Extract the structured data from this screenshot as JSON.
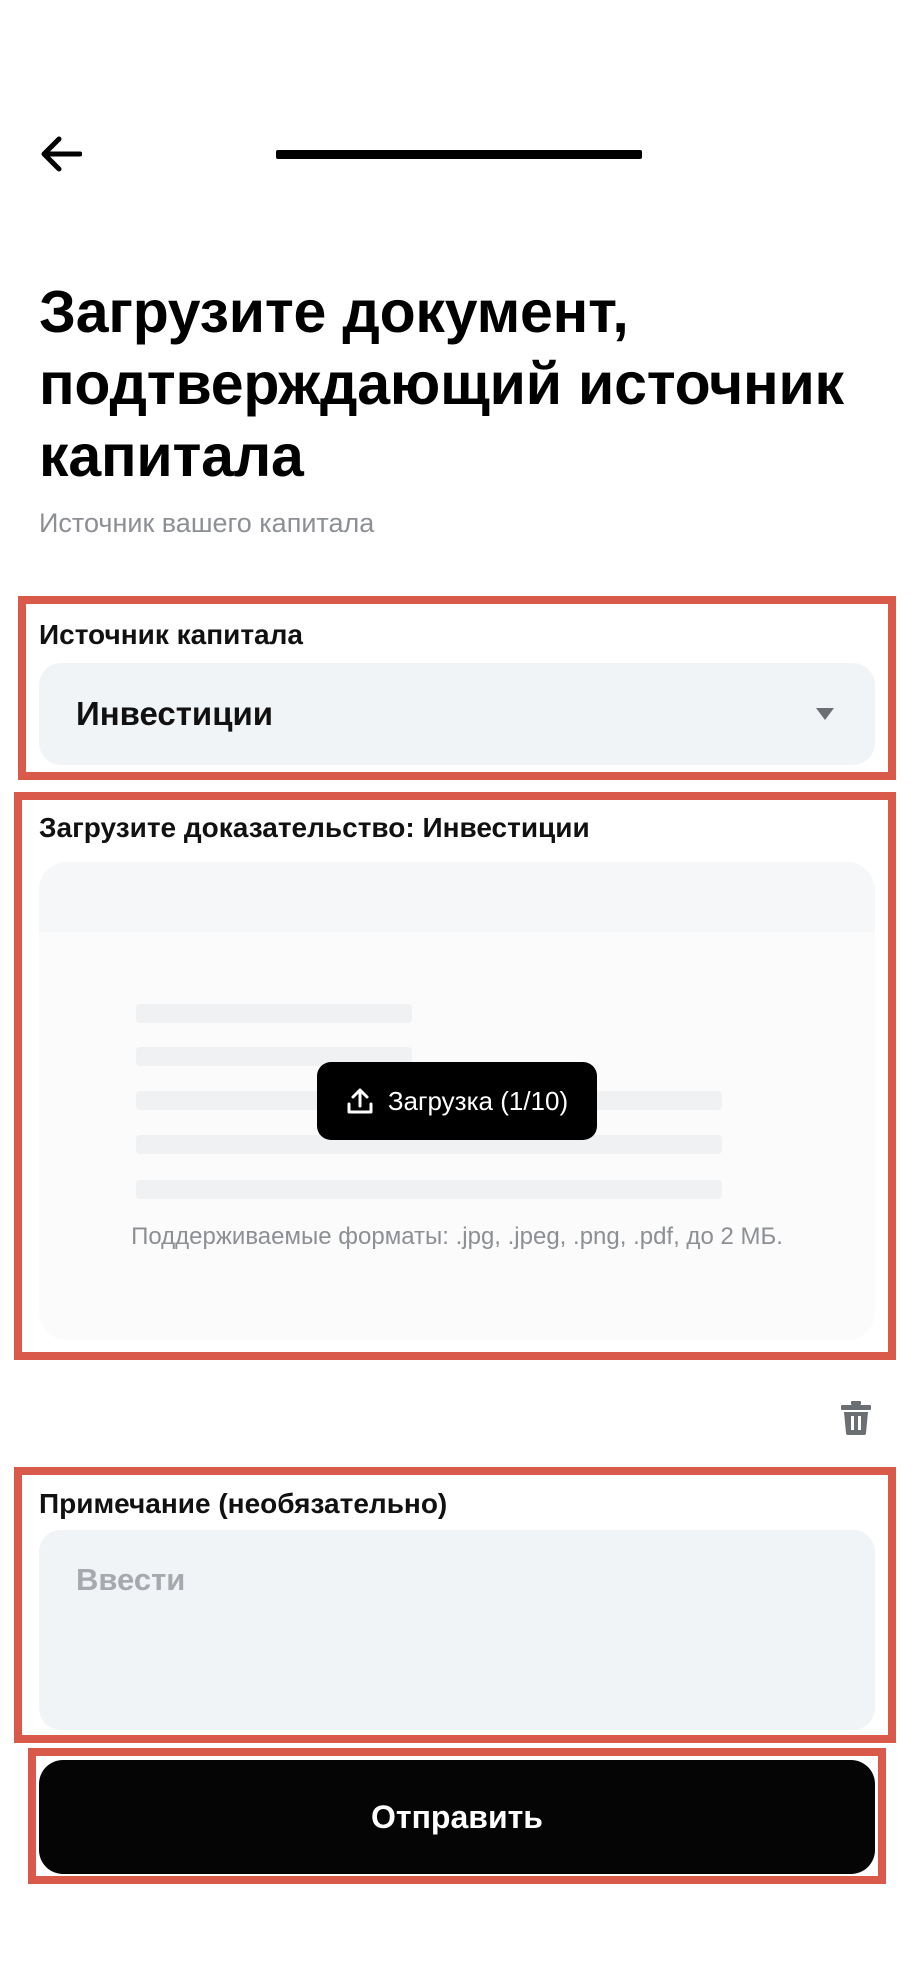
{
  "header": {
    "back_icon": "arrow-left-icon",
    "progress_percent": 100
  },
  "page": {
    "title": "Загрузите документ, подтверждающий источник капитала",
    "subtitle": "Источник вашего капитала"
  },
  "capital_source": {
    "label": "Источник капитала",
    "selected_value": "Инвестиции",
    "dropdown_icon": "caret-down-icon"
  },
  "upload": {
    "label": "Загрузите доказательство: Инвестиции",
    "button_label": "Загрузка (1/10)",
    "button_icon": "upload-icon",
    "hint": "Поддерживаемые форматы: .jpg, .jpeg, .png, .pdf, до 2 МБ.",
    "delete_icon": "trash-icon"
  },
  "note": {
    "label": "Примечание (необязательно)",
    "placeholder": "Ввести",
    "value": ""
  },
  "submit": {
    "label": "Отправить"
  },
  "colors": {
    "accent": "#000000",
    "field_background": "#f1f4f6",
    "highlight": "#d95a4a",
    "muted_text": "#8c8f93"
  }
}
